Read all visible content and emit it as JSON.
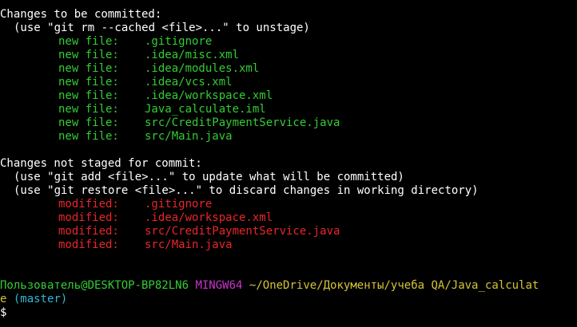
{
  "staged": {
    "header": "Changes to be committed:",
    "hint": "(use \"git rm --cached <file>...\" to unstage)",
    "files": [
      {
        "status": "new file:",
        "path": ".gitignore"
      },
      {
        "status": "new file:",
        "path": ".idea/misc.xml"
      },
      {
        "status": "new file:",
        "path": ".idea/modules.xml"
      },
      {
        "status": "new file:",
        "path": ".idea/vcs.xml"
      },
      {
        "status": "new file:",
        "path": ".idea/workspace.xml"
      },
      {
        "status": "new file:",
        "path": "Java_calculate.iml"
      },
      {
        "status": "new file:",
        "path": "src/CreditPaymentService.java"
      },
      {
        "status": "new file:",
        "path": "src/Main.java"
      }
    ]
  },
  "unstaged": {
    "header": "Changes not staged for commit:",
    "hints": [
      "(use \"git add <file>...\" to update what will be committed)",
      "(use \"git restore <file>...\" to discard changes in working directory)"
    ],
    "files": [
      {
        "status": "modified:",
        "path": ".gitignore"
      },
      {
        "status": "modified:",
        "path": ".idea/workspace.xml"
      },
      {
        "status": "modified:",
        "path": "src/CreditPaymentService.java"
      },
      {
        "status": "modified:",
        "path": "src/Main.java"
      }
    ]
  },
  "prompt": {
    "user_host": "Пользователь@DESKTOP-BP82LN6",
    "env": "MINGW64",
    "path_line1": "~/OneDrive/Документы/учеба QA/Java_calculat",
    "path_line2": "e",
    "branch": "(master)",
    "symbol": "$"
  },
  "colors": {
    "background": "#000000",
    "text": "#ffffff",
    "staged": "#33cc33",
    "unstaged": "#e8262a",
    "user_host": "#33cc33",
    "env": "#cc33cc",
    "path": "#d4c437",
    "branch": "#2fb8d6"
  }
}
